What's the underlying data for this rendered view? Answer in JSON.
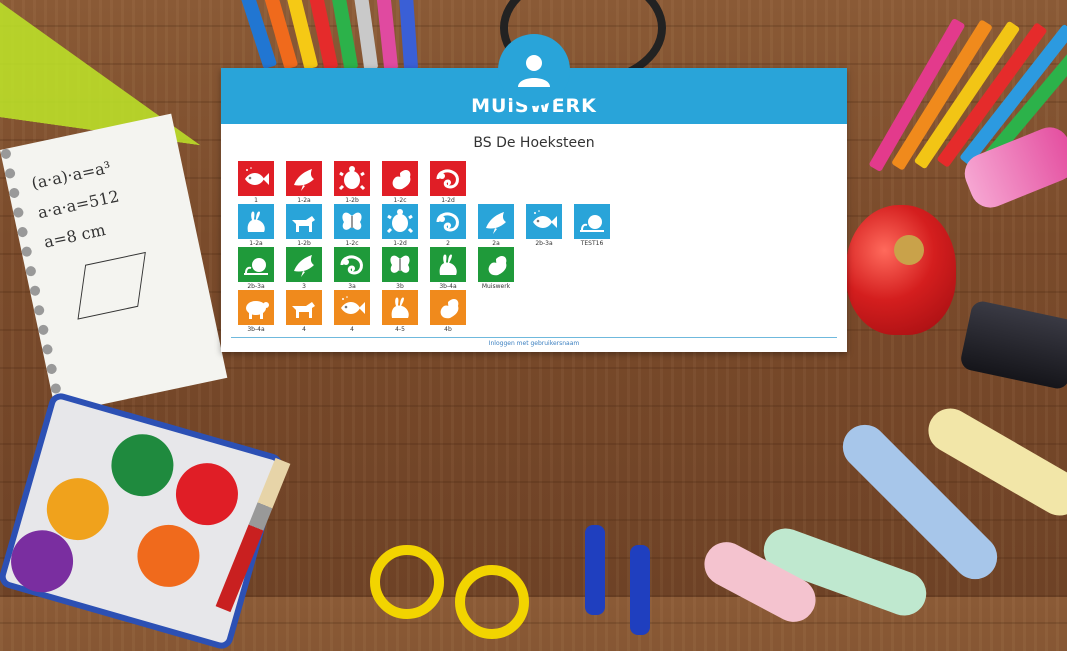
{
  "brand": {
    "name": "MUiSWERK",
    "accent": "#29a4d9"
  },
  "school": {
    "title": "BS De Hoeksteen"
  },
  "colors": {
    "red": "#e01e26",
    "blue": "#29a4d9",
    "green": "#1f9a3a",
    "orange": "#f08a1c"
  },
  "rows": [
    [
      {
        "label": "1",
        "color": "red",
        "icon": "fish-icon"
      },
      {
        "label": "1-2a",
        "color": "red",
        "icon": "bird-icon"
      },
      {
        "label": "1-2b",
        "color": "red",
        "icon": "turtle-icon"
      },
      {
        "label": "1-2c",
        "color": "red",
        "icon": "squirrel-icon"
      },
      {
        "label": "1-2d",
        "color": "red",
        "icon": "chameleon-icon"
      }
    ],
    [
      {
        "label": "1-2a",
        "color": "blue",
        "icon": "rabbit-icon"
      },
      {
        "label": "1-2b",
        "color": "blue",
        "icon": "dog-icon"
      },
      {
        "label": "1-2c",
        "color": "blue",
        "icon": "butterfly-icon"
      },
      {
        "label": "1-2d",
        "color": "blue",
        "icon": "turtle-icon"
      },
      {
        "label": "2",
        "color": "blue",
        "icon": "chameleon-icon"
      },
      {
        "label": "2a",
        "color": "blue",
        "icon": "bird-icon"
      },
      {
        "label": "2b-3a",
        "color": "blue",
        "icon": "fish-icon"
      },
      {
        "label": "TEST16",
        "color": "blue",
        "icon": "snail-icon"
      }
    ],
    [
      {
        "label": "2b-3a",
        "color": "green",
        "icon": "snail-icon"
      },
      {
        "label": "3",
        "color": "green",
        "icon": "bird-icon"
      },
      {
        "label": "3a",
        "color": "green",
        "icon": "chameleon-icon"
      },
      {
        "label": "3b",
        "color": "green",
        "icon": "butterfly-icon"
      },
      {
        "label": "3b-4a",
        "color": "green",
        "icon": "rabbit-icon"
      },
      {
        "label": "Muiswerk",
        "color": "green",
        "icon": "squirrel-icon"
      }
    ],
    [
      {
        "label": "3b-4a",
        "color": "orange",
        "icon": "sheep-icon"
      },
      {
        "label": "4",
        "color": "orange",
        "icon": "dog-icon"
      },
      {
        "label": "4",
        "color": "orange",
        "icon": "fish-icon"
      },
      {
        "label": "4-5",
        "color": "orange",
        "icon": "rabbit-icon"
      },
      {
        "label": "4b",
        "color": "orange",
        "icon": "squirrel-icon"
      }
    ]
  ],
  "footer": {
    "link_label": "Inloggen met gebruikersnaam"
  }
}
